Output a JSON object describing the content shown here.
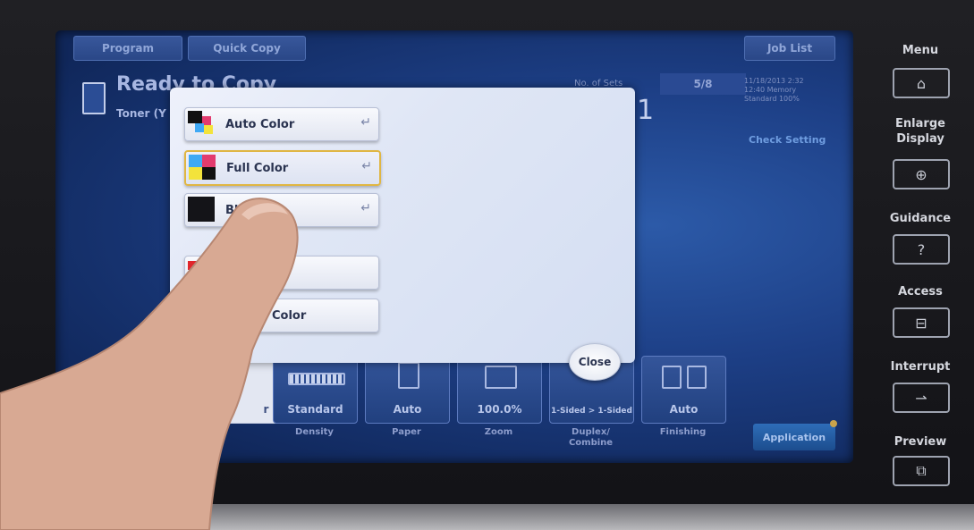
{
  "top_tabs": [
    "Program",
    "Quick Copy",
    "Job List"
  ],
  "status": {
    "title": "Ready to Copy",
    "subtitle": "Toner (Y",
    "copies_label": "No. of Sets",
    "copies_box": "5/8",
    "copies_number": "1",
    "info_lines": [
      "11/18/2013  2:32",
      "12:40  Memory",
      "Standard  100%"
    ],
    "check_setting": "Check Setting"
  },
  "functions": [
    {
      "label": "",
      "value": "r"
    },
    {
      "label": "Density",
      "value": "Standard"
    },
    {
      "label": "Paper",
      "value": "Auto"
    },
    {
      "label": "Zoom",
      "value": "100.0%"
    },
    {
      "label": "Duplex/ Combine",
      "value": "1-Sided > 1-Sided"
    },
    {
      "label": "Finishing",
      "value": "Auto"
    }
  ],
  "application_button": "Application",
  "dialog": {
    "options": [
      {
        "label": "Auto Color",
        "selected": false
      },
      {
        "label": "Full Color",
        "selected": true
      },
      {
        "label": "Bla",
        "selected": false
      },
      {
        "label": "",
        "selected": false
      },
      {
        "label": "Color",
        "selected": false
      }
    ],
    "close_label": "Close"
  },
  "side_panel": {
    "menu": "Menu",
    "enlarge": "Enlarge Display",
    "guidance": "Guidance",
    "access": "Access",
    "interrupt": "Interrupt",
    "preview": "Preview"
  },
  "colors": {
    "accent_selected": "#e0b642",
    "screen_bg": "#1d3f86"
  },
  "icons": [
    "home-icon",
    "zoom-in-icon",
    "help-icon",
    "access-icon",
    "interrupt-icon",
    "preview-icon"
  ]
}
